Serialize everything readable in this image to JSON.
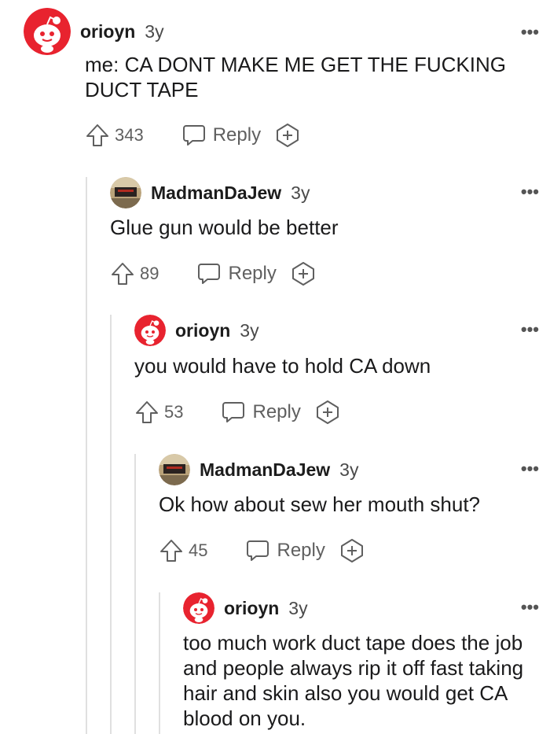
{
  "comments": [
    {
      "username": "orioyn",
      "age": "3y",
      "body": "me: CA DONT MAKE ME GET THE FUCKING DUCT TAPE",
      "score": "343",
      "reply_label": "Reply",
      "avatar": "snoo-avatar"
    },
    {
      "username": "MadmanDaJew",
      "age": "3y",
      "body": "Glue gun would be better",
      "score": "89",
      "reply_label": "Reply",
      "avatar": "photo-avatar"
    },
    {
      "username": "orioyn",
      "age": "3y",
      "body": "you would have to hold CA down",
      "score": "53",
      "reply_label": "Reply",
      "avatar": "snoo-avatar"
    },
    {
      "username": "MadmanDaJew",
      "age": "3y",
      "body": "Ok how about sew her mouth shut?",
      "score": "45",
      "reply_label": "Reply",
      "avatar": "photo-avatar"
    },
    {
      "username": "orioyn",
      "age": "3y",
      "body": "too much work duct tape does the job and people always rip it off fast taking hair and skin also you would get CA blood on you.",
      "avatar": "snoo-avatar"
    }
  ],
  "more_label": "•••",
  "colors": {
    "snoo_red": "#e8232f",
    "thread_line": "#e0e0e0",
    "meta_gray": "#5f5f5f"
  }
}
